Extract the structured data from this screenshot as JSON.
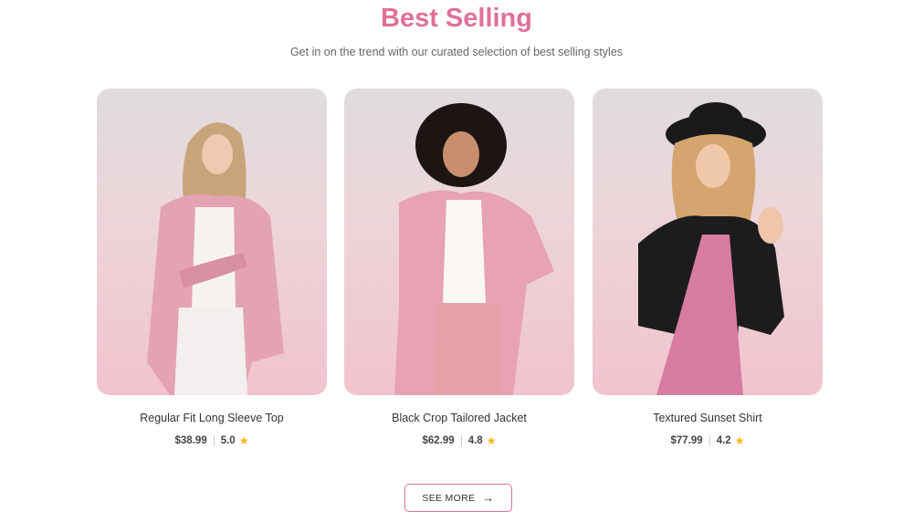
{
  "section": {
    "title": "Best Selling",
    "subtitle": "Get in on the trend with our curated selection of best selling styles"
  },
  "products": [
    {
      "name": "Regular Fit Long Sleeve Top",
      "price": "$38.99",
      "rating": "5.0"
    },
    {
      "name": "Black Crop Tailored Jacket",
      "price": "$62.99",
      "rating": "4.8"
    },
    {
      "name": "Textured Sunset Shirt",
      "price": "$77.99",
      "rating": "4.2"
    }
  ],
  "cta": {
    "label": "SEE MORE",
    "icon": "arrow-right-icon"
  },
  "colors": {
    "accent": "#e0709a",
    "star": "#f5b70a"
  }
}
